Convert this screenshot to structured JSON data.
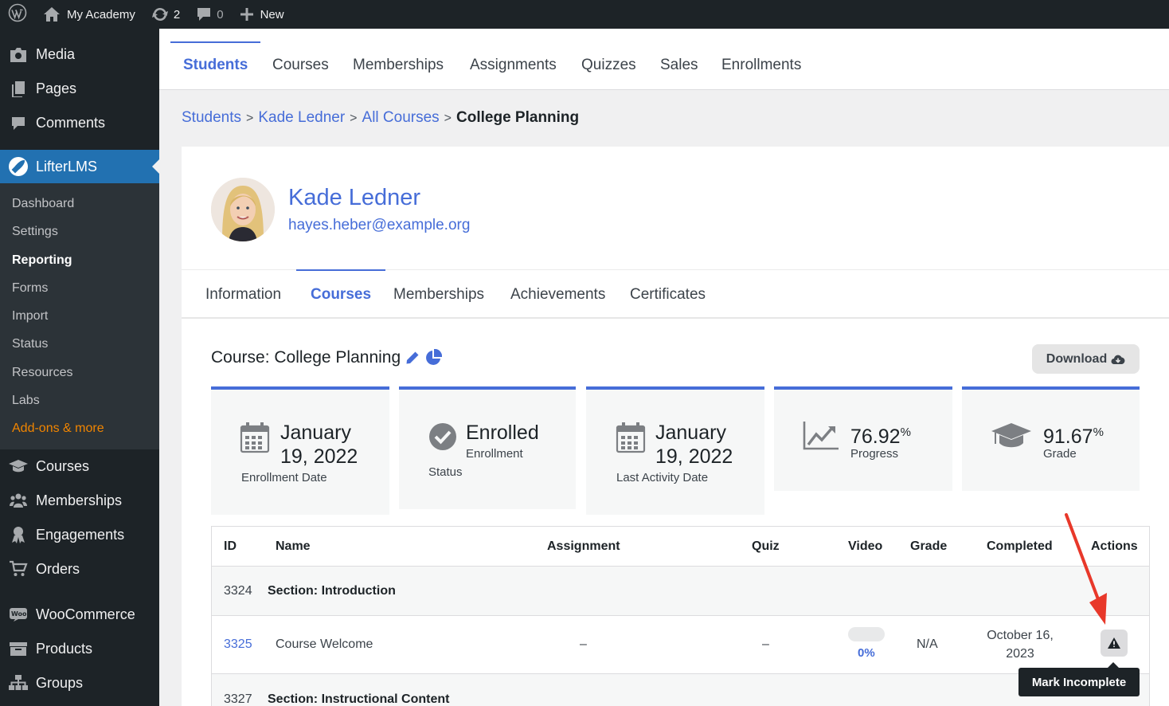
{
  "adminbar": {
    "site_name": "My Academy",
    "updates_count": "2",
    "comments_count": "0",
    "new_label": "New"
  },
  "sidebar": {
    "items_top": [
      {
        "label": "Media",
        "icon": "media-icon"
      },
      {
        "label": "Pages",
        "icon": "pages-icon"
      },
      {
        "label": "Comments",
        "icon": "comments-icon"
      }
    ],
    "active": {
      "label": "LifterLMS",
      "icon": "lifterlms-rocket-icon"
    },
    "submenu": [
      "Dashboard",
      "Settings",
      "Reporting",
      "Forms",
      "Import",
      "Status",
      "Resources",
      "Labs",
      "Add-ons & more"
    ],
    "items_bottom": [
      {
        "label": "Courses",
        "icon": "courses-icon"
      },
      {
        "label": "Memberships",
        "icon": "memberships-icon"
      },
      {
        "label": "Engagements",
        "icon": "engagements-icon"
      },
      {
        "label": "Orders",
        "icon": "orders-cart-icon"
      },
      {
        "label": "WooCommerce",
        "icon": "woocommerce-icon"
      },
      {
        "label": "Products",
        "icon": "products-icon"
      },
      {
        "label": "Groups",
        "icon": "groups-icon"
      }
    ]
  },
  "topnav": {
    "tabs": [
      "Students",
      "Courses",
      "Memberships",
      "Assignments",
      "Quizzes",
      "Sales",
      "Enrollments"
    ],
    "active": "Students"
  },
  "breadcrumb": {
    "items": [
      "Students",
      "Kade Ledner",
      "All Courses"
    ],
    "current": "College Planning",
    "separator": ">"
  },
  "student": {
    "name": "Kade Ledner",
    "email": "hayes.heber@example.org"
  },
  "subtabs": {
    "tabs": [
      "Information",
      "Courses",
      "Memberships",
      "Achievements",
      "Certificates"
    ],
    "active": "Courses"
  },
  "course": {
    "title": "Course: College Planning",
    "download_label": "Download"
  },
  "stats": {
    "enrollment_date": {
      "line1": "January",
      "line2": "19, 2022",
      "label": "Enrollment Date"
    },
    "status": {
      "value": "Enrolled",
      "sub": "Enrollment",
      "label": "Status"
    },
    "last_activity": {
      "line1": "January",
      "line2": "19, 2022",
      "label": "Last Activity Date"
    },
    "progress": {
      "value": "76.92",
      "unit": "%",
      "label": "Progress"
    },
    "grade": {
      "value": "91.67",
      "unit": "%",
      "label": "Grade"
    }
  },
  "table": {
    "headers": [
      "ID",
      "Name",
      "Assignment",
      "Quiz",
      "Video",
      "Grade",
      "Completed",
      "Actions"
    ],
    "rows": [
      {
        "type": "section",
        "id": "3324",
        "name": "Section: Introduction"
      },
      {
        "type": "lesson",
        "id": "3325",
        "name": "Course Welcome",
        "assignment": "–",
        "quiz": "–",
        "video": "0%",
        "video_progress": 0,
        "grade": "N/A",
        "completed_line1": "October 16,",
        "completed_line2": "2023"
      },
      {
        "type": "section",
        "id": "3327",
        "name": "Section: Instructional Content"
      }
    ]
  },
  "tooltip": "Mark Incomplete",
  "colors": {
    "accent": "#466dd8",
    "wp_dark": "#1d2327",
    "wp_blue": "#2271b1",
    "addons_orange": "#f18500",
    "annotation_red": "#e8382a"
  }
}
